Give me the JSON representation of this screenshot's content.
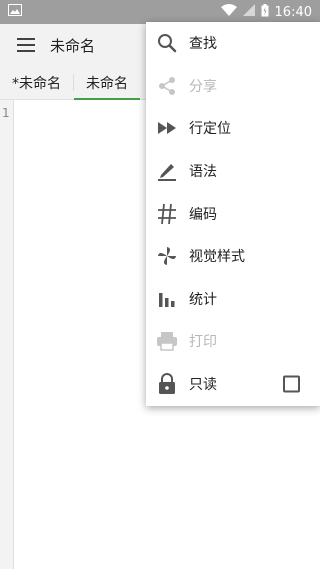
{
  "colors": {
    "accent": "#43a047",
    "status_bar": "#9e9e9e",
    "toolbar_bg": "#f2f2f2"
  },
  "status_bar": {
    "time": "16:40",
    "icons": [
      "image-icon",
      "wifi-icon",
      "signal-icon",
      "battery-icon"
    ]
  },
  "toolbar": {
    "title": "未命名"
  },
  "tabs": [
    {
      "label": "*未命名",
      "active": false
    },
    {
      "label": "未命名",
      "active": true
    }
  ],
  "editor": {
    "line_numbers": [
      "1"
    ]
  },
  "menu": {
    "items": [
      {
        "label": "查找",
        "icon": "search-icon",
        "disabled": false
      },
      {
        "label": "分享",
        "icon": "share-icon",
        "disabled": true
      },
      {
        "label": "行定位",
        "icon": "fast-forward-icon",
        "disabled": false
      },
      {
        "label": "语法",
        "icon": "pen-icon",
        "disabled": false
      },
      {
        "label": "编码",
        "icon": "hash-icon",
        "disabled": false
      },
      {
        "label": "视觉样式",
        "icon": "pinwheel-icon",
        "disabled": false
      },
      {
        "label": "统计",
        "icon": "bar-chart-icon",
        "disabled": false
      },
      {
        "label": "打印",
        "icon": "printer-icon",
        "disabled": true
      },
      {
        "label": "只读",
        "icon": "lock-icon",
        "disabled": false,
        "checked": false
      }
    ]
  }
}
